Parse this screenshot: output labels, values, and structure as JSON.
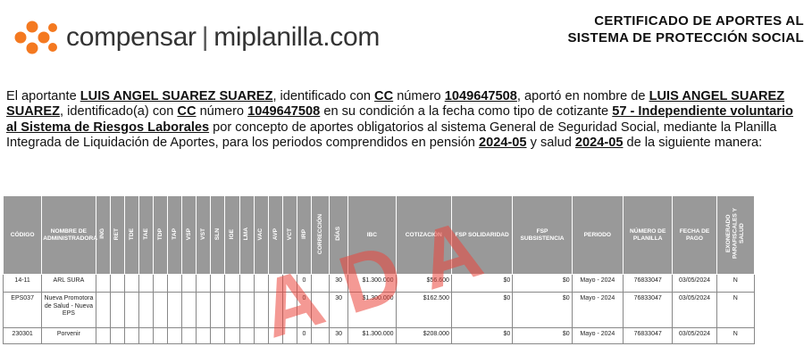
{
  "logo": {
    "brand": "compensar",
    "separator": "|",
    "product": "miplanilla.com"
  },
  "header": {
    "title_line1": "CERTIFICADO DE APORTES AL",
    "title_line2": "SISTEMA DE PROTECCIÓN SOCIAL"
  },
  "statement": {
    "t1": "El aportante ",
    "aportante": "LUIS ANGEL SUAREZ SUAREZ",
    "t2": ", identificado con ",
    "doc_type_1": "CC",
    "t3": " número ",
    "doc_number_1": "1049647508",
    "t4": ", aportó en nombre de ",
    "cotizante": "LUIS ANGEL SUAREZ SUAREZ",
    "t5": ", identificado(a) con ",
    "doc_type_2": "CC",
    "t6": "  número ",
    "doc_number_2": "1049647508",
    "t7": " en su condición a la fecha como tipo de cotizante ",
    "tipo_cotizante": "57 - Independiente voluntario al Sistema de Riesgos Laborales",
    "t8": " por concepto de aportes obligatorios al sistema General de Seguridad Social, mediante la Planilla Integrada de Liquidación de Aportes, para los periodos comprendidos en pensión ",
    "periodo_pension": "2024-05",
    "t9": " y salud ",
    "periodo_salud": "2024-05",
    "t10": " de la siguiente manera:"
  },
  "table": {
    "headers": [
      "CÓDIGO",
      "NOMBRE DE ADMINISTRADORA",
      "ING",
      "RET",
      "TDE",
      "TAE",
      "TDP",
      "TAP",
      "VSP",
      "VST",
      "SLN",
      "IGE",
      "LMA",
      "VAC",
      "AVP",
      "VCT",
      "IRP",
      "CORRECCIÓN",
      "DÍAS",
      "IBC",
      "COTIZACIÓN",
      "FSP SOLIDARIDAD",
      "FSP SUBSISTENCIA",
      "PERIODO",
      "NÚMERO DE PLANILLA",
      "FECHA DE PAGO",
      "EXONERADO PARAFISCALES Y SALUD"
    ],
    "rows": [
      [
        "14-11",
        "ARL SURA",
        "",
        "",
        "",
        "",
        "",
        "",
        "",
        "",
        "",
        "",
        "",
        "",
        "",
        "",
        "0",
        "",
        "30",
        "$1.300.000",
        "$56.600",
        "$0",
        "$0",
        "Mayo - 2024",
        "76833047",
        "03/05/2024",
        "N"
      ],
      [
        "EPS037",
        "Nueva Promotora de Salud - Nueva EPS",
        "",
        "",
        "",
        "",
        "",
        "",
        "",
        "",
        "",
        "",
        "",
        "",
        "",
        "",
        "0",
        "",
        "30",
        "$1.300.000",
        "$162.500",
        "$0",
        "$0",
        "Mayo - 2024",
        "76833047",
        "03/05/2024",
        "N"
      ],
      [
        "230301",
        "Porvenir",
        "",
        "",
        "",
        "",
        "",
        "",
        "",
        "",
        "",
        "",
        "",
        "",
        "",
        "",
        "0",
        "",
        "30",
        "$1.300.000",
        "$208.000",
        "$0",
        "$0",
        "Mayo - 2024",
        "76833047",
        "03/05/2024",
        "N"
      ]
    ]
  },
  "watermark": "ADA",
  "colors": {
    "logo_orange": "#f47920",
    "header_gray": "#999999",
    "watermark_red": "#eb463c"
  }
}
